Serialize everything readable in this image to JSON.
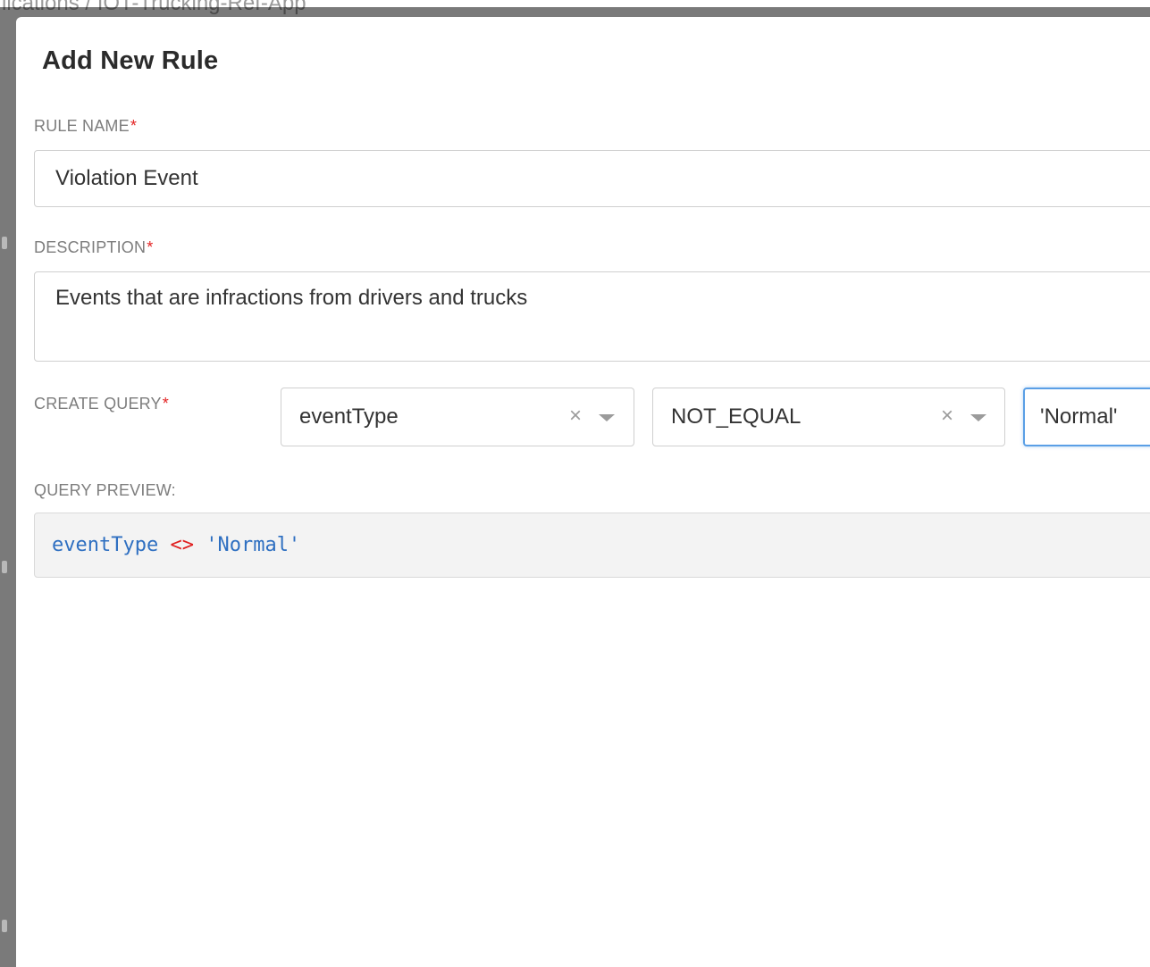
{
  "background": {
    "breadcrumb": "lications / IOT-Trucking-Ref-App"
  },
  "modal": {
    "title": "Add New Rule"
  },
  "rule_name": {
    "label": "RULE NAME",
    "required_mark": "*",
    "value": "Violation Event"
  },
  "description": {
    "label": "DESCRIPTION",
    "required_mark": "*",
    "value": "Events that are infractions from drivers and trucks"
  },
  "create_query": {
    "label": "CREATE QUERY",
    "required_mark": "*",
    "field_select": {
      "value": "eventType",
      "clear_icon": "×"
    },
    "operator_select": {
      "value": "NOT_EQUAL",
      "clear_icon": "×"
    },
    "value_input": {
      "value": "'Normal'"
    }
  },
  "query_preview": {
    "label": "QUERY PREVIEW:",
    "field": "eventType",
    "operator": "<>",
    "value": "'Normal'"
  },
  "colors": {
    "required": "#e32424",
    "focus_border": "#5a9fe6",
    "code_field": "#2e6fc1",
    "code_operator": "#e01e1e"
  }
}
